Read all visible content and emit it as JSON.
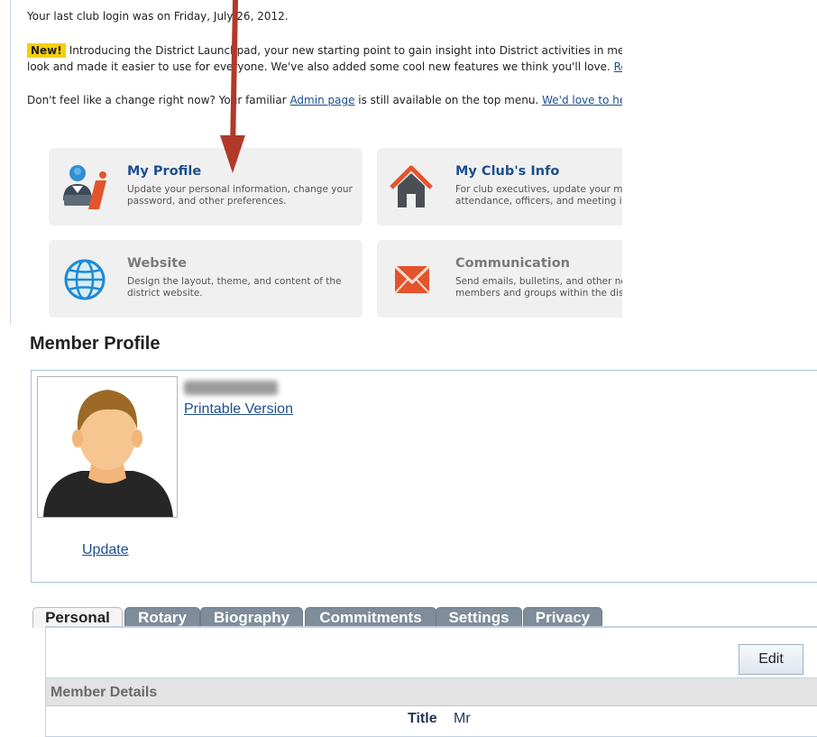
{
  "intro": {
    "last_login": "Your last club login was on Friday, July 26, 2012.",
    "new_badge": "New!",
    "launchpad_line1": "Introducing the District Launchpad, your new starting point to gain insight into District activities in members",
    "launchpad_line2_text": "look and made it easier to use for everyone. We've also added some cool new features we think you'll love. ",
    "launchpad_line2_link": "Read",
    "change_text_before": "Don't feel like a change right now? Your familiar ",
    "admin_link": "Admin page",
    "change_text_after": " is still available on the top menu. ",
    "hear_link": "We'd love to hear y"
  },
  "tiles": [
    {
      "title": "My Profile",
      "desc_line1": "Update your personal information, change your",
      "desc_line2": "password, and other preferences.",
      "icon": "profile-icon"
    },
    {
      "title": "My Club's Info",
      "desc_line1": "For club executives, update your mem",
      "desc_line2": "attendance, officers, and meeting info",
      "icon": "house-icon"
    },
    {
      "title": "Website",
      "desc_line1": "Design the layout, theme, and content of the",
      "desc_line2": "district website.",
      "icon": "globe-icon"
    },
    {
      "title": "Communication",
      "desc_line1": "Send emails, bulletins, and other notic",
      "desc_line2": "members and groups within the district",
      "icon": "envelope-icon"
    }
  ],
  "colors": {
    "link": "#1d4e8f",
    "arrow": "#b1392a",
    "badge": "#f4d00c",
    "tab_inactive": "#7f8c9a"
  },
  "profile": {
    "heading": "Member Profile",
    "printable_link": "Printable Version",
    "update_link": "Update"
  },
  "tabs": [
    "Personal",
    "Rotary",
    "Biography",
    "Commitments",
    "Settings",
    "Privacy"
  ],
  "details": {
    "edit_button": "Edit",
    "section_title": "Member Details",
    "title_label": "Title",
    "title_value": "Mr"
  }
}
